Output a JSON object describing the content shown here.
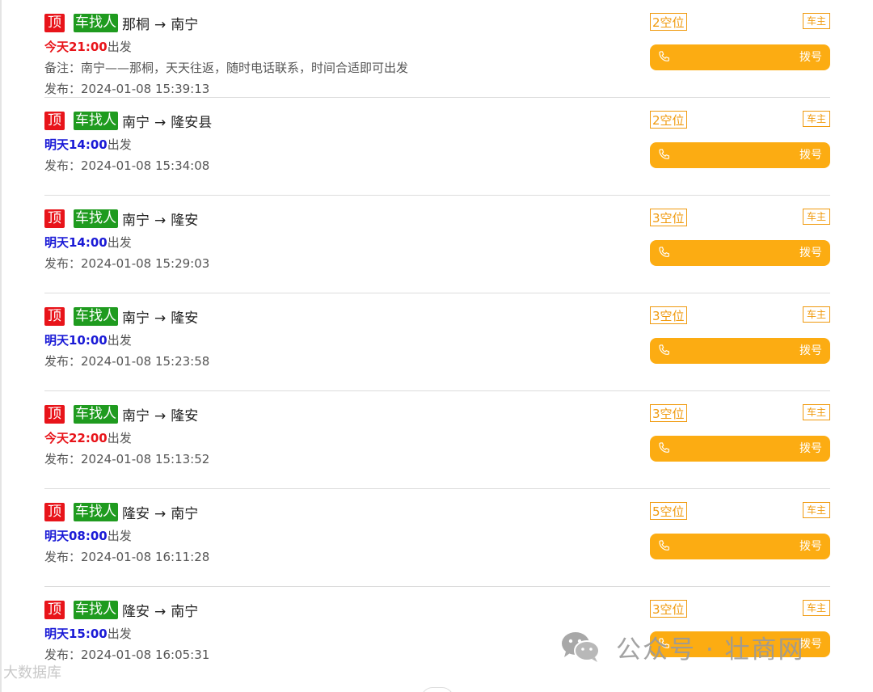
{
  "labels": {
    "top": "顶",
    "type": "车找人",
    "arrow": "→",
    "depart_suffix": "出发",
    "publish_prefix": "发布：",
    "role": "车主",
    "dial": "拨号"
  },
  "listings": [
    {
      "from": "那桐",
      "to": "南宁",
      "depart": "今天21:00",
      "note": "备注：南宁——那桐，天天往返，随时电话联系，时间合适即可出发",
      "published": "2024-01-08 15:39:13",
      "seats": "2空位"
    },
    {
      "from": "南宁",
      "to": "隆安县",
      "depart": "明天14:00",
      "published": "2024-01-08 15:34:08",
      "seats": "2空位"
    },
    {
      "from": "南宁",
      "to": "隆安",
      "depart": "明天14:00",
      "published": "2024-01-08 15:29:03",
      "seats": "3空位"
    },
    {
      "from": "南宁",
      "to": "隆安",
      "depart": "明天10:00",
      "published": "2024-01-08 15:23:58",
      "seats": "3空位"
    },
    {
      "from": "南宁",
      "to": "隆安",
      "depart": "今天22:00",
      "published": "2024-01-08 15:13:52",
      "seats": "3空位"
    },
    {
      "from": "隆安",
      "to": "南宁",
      "depart": "明天08:00",
      "published": "2024-01-08 16:11:28",
      "seats": "5空位"
    },
    {
      "from": "隆安",
      "to": "南宁",
      "depart": "明天15:00",
      "published": "2024-01-08 16:05:31",
      "seats": "3空位"
    }
  ],
  "watermark": {
    "text": "公众号 · 壮商网",
    "corner_text": "大数据库",
    "icon": "wechat-icon"
  },
  "colors": {
    "top_tag": "#e8141a",
    "type_tag": "#1f9b1f",
    "today": "#e8141a",
    "tomorrow": "#1a1ad6",
    "accent": "#fcac12",
    "seats_border": "#f09a0e"
  },
  "icons": {
    "dial": "phone-icon"
  }
}
